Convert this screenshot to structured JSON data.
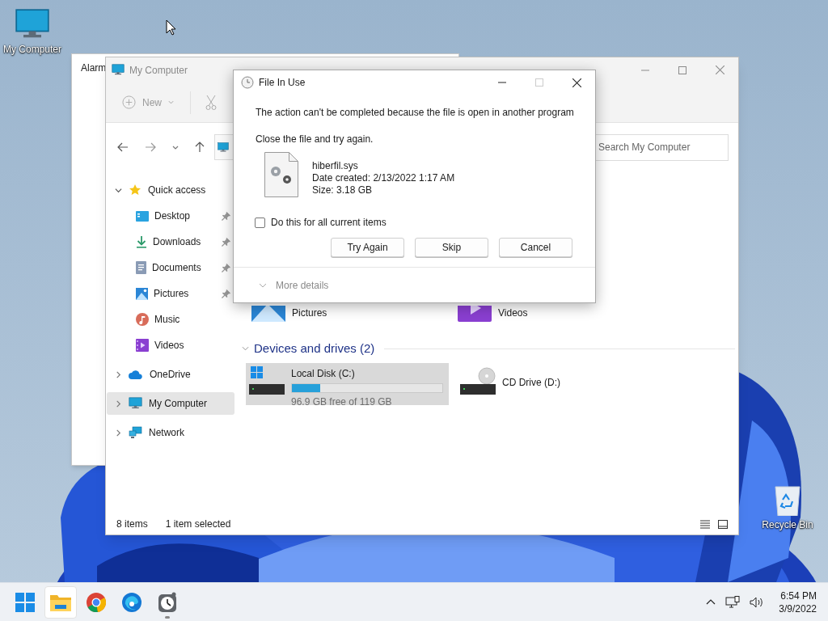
{
  "desktop_icons": [
    {
      "label": "My Computer",
      "kind": "computer"
    },
    {
      "label": "Recycle Bin",
      "kind": "recycle"
    }
  ],
  "background_window": {
    "title": "Alarm"
  },
  "explorer": {
    "title": "My Computer",
    "new_label": "New",
    "search": {
      "placeholder": "Search My Computer"
    },
    "sidebar": [
      {
        "label": "Quick access",
        "kind": "star",
        "expanded": true,
        "selected": false,
        "children": [
          {
            "label": "Desktop",
            "kind": "desktop",
            "pinned": true,
            "selected": false
          },
          {
            "label": "Downloads",
            "kind": "downloads",
            "pinned": true,
            "selected": false
          },
          {
            "label": "Documents",
            "kind": "documents",
            "pinned": true,
            "selected": false
          },
          {
            "label": "Pictures",
            "kind": "pictures",
            "pinned": true,
            "selected": false
          },
          {
            "label": "Music",
            "kind": "music",
            "pinned": false,
            "selected": false
          },
          {
            "label": "Videos",
            "kind": "videos",
            "pinned": false,
            "selected": false
          }
        ]
      },
      {
        "label": "OneDrive",
        "kind": "cloud",
        "expanded": false,
        "selected": false
      },
      {
        "label": "My Computer",
        "kind": "computer",
        "expanded": false,
        "selected": true
      },
      {
        "label": "Network",
        "kind": "network",
        "expanded": false,
        "selected": false
      }
    ],
    "folders": [
      {
        "label": "Pictures",
        "kind": "pictures"
      },
      {
        "label": "Videos",
        "kind": "videos"
      }
    ],
    "drives_header": "Devices and drives (2)",
    "drives": [
      {
        "label": "Local Disk (C:)",
        "kind": "disk",
        "level": 0.19,
        "reading": "96.9 GB free of 119 GB",
        "selected": true
      },
      {
        "label": "CD Drive (D:)",
        "kind": "cd",
        "selected": false
      }
    ],
    "status_bar": {
      "count": "8 items",
      "selection": "1 item selected"
    }
  },
  "dialog": {
    "title": "File In Use",
    "message": "The action can't be completed because the file is open in another program",
    "hint": "Close the file and try again.",
    "file": {
      "name": "hiberfil.sys",
      "created": "Date created: 2/13/2022 1:17 AM",
      "size": "Size: 3.18 GB"
    },
    "checkbox": {
      "label": "Do this for all current items",
      "checked": false
    },
    "buttons": [
      "Try Again",
      "Skip",
      "Cancel"
    ],
    "more_details": "More details"
  },
  "taskbar": {
    "apps": [
      {
        "kind": "start",
        "selected": false,
        "running": false
      },
      {
        "kind": "explorer",
        "selected": true,
        "running": false
      },
      {
        "kind": "chrome",
        "selected": false,
        "running": false
      },
      {
        "kind": "edge",
        "selected": false,
        "running": false
      },
      {
        "kind": "clock",
        "selected": false,
        "running": true
      }
    ],
    "time": "6:54 PM",
    "date": "3/9/2022"
  }
}
